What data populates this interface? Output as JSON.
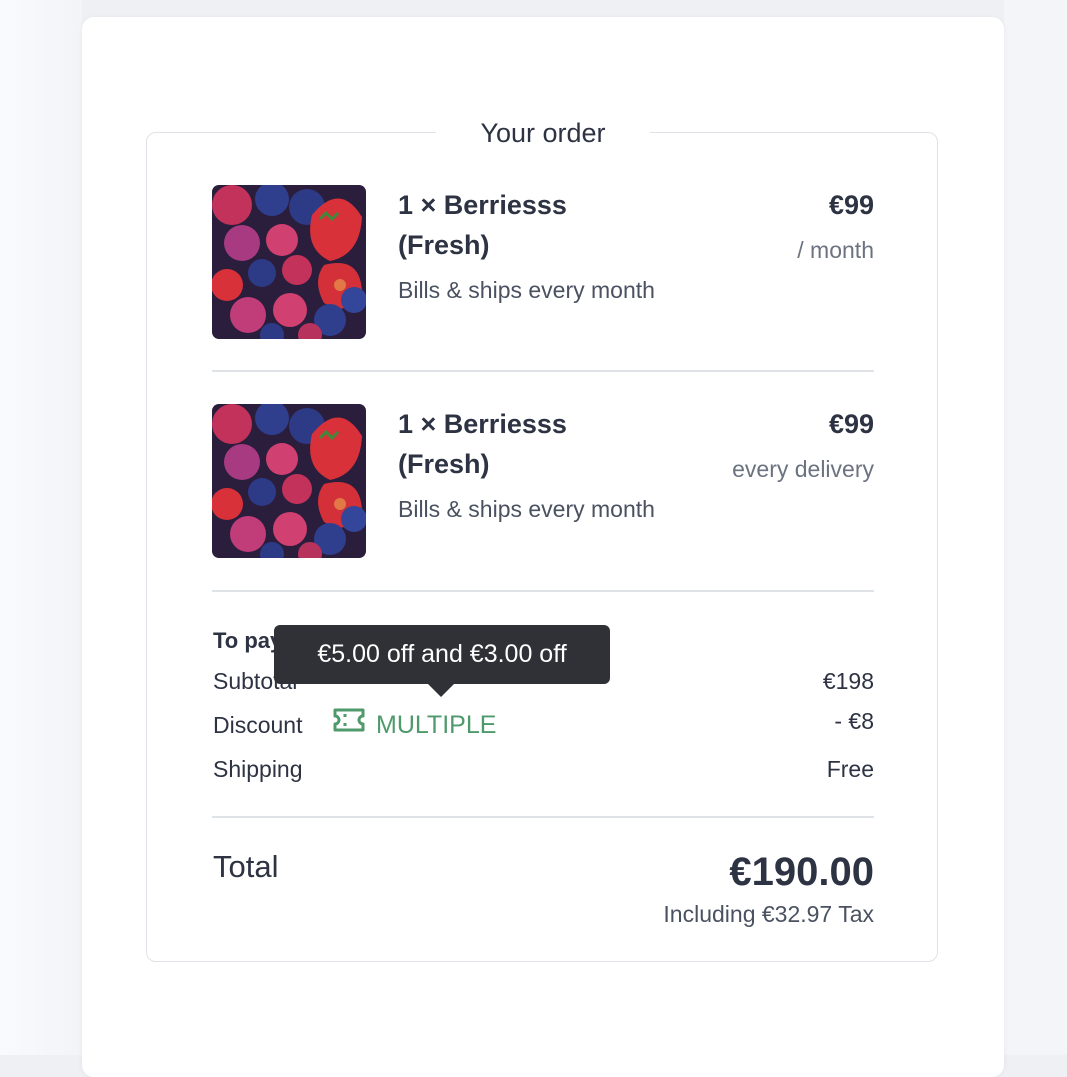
{
  "order": {
    "heading": "Your order",
    "items": [
      {
        "name": "1 × Berriesss (Fresh)",
        "billing": "Bills & ships every month",
        "price": "€99",
        "period": "/ month"
      },
      {
        "name": "1 × Berriesss (Fresh)",
        "billing": "Bills & ships every month",
        "price": "€99",
        "period": "every delivery"
      }
    ],
    "summary": {
      "to_pay_label": "To pay",
      "subtotal_label": "Subtotal",
      "subtotal_value": "€198",
      "discount_label": "Discount",
      "discount_code": "MULTIPLE",
      "discount_value": "- €8",
      "shipping_label": "Shipping",
      "shipping_value": "Free"
    },
    "tooltip": "€5.00 off and €3.00 off",
    "total": {
      "label": "Total",
      "value": "€190.00",
      "tax_note": "Including €32.97 Tax"
    }
  },
  "colors": {
    "accent_green": "#4f9a6c",
    "text_dark": "#2d3343",
    "text_muted": "#6b7380",
    "tooltip_bg": "#2f3136"
  },
  "icons": {
    "discount": "ticket-icon"
  }
}
